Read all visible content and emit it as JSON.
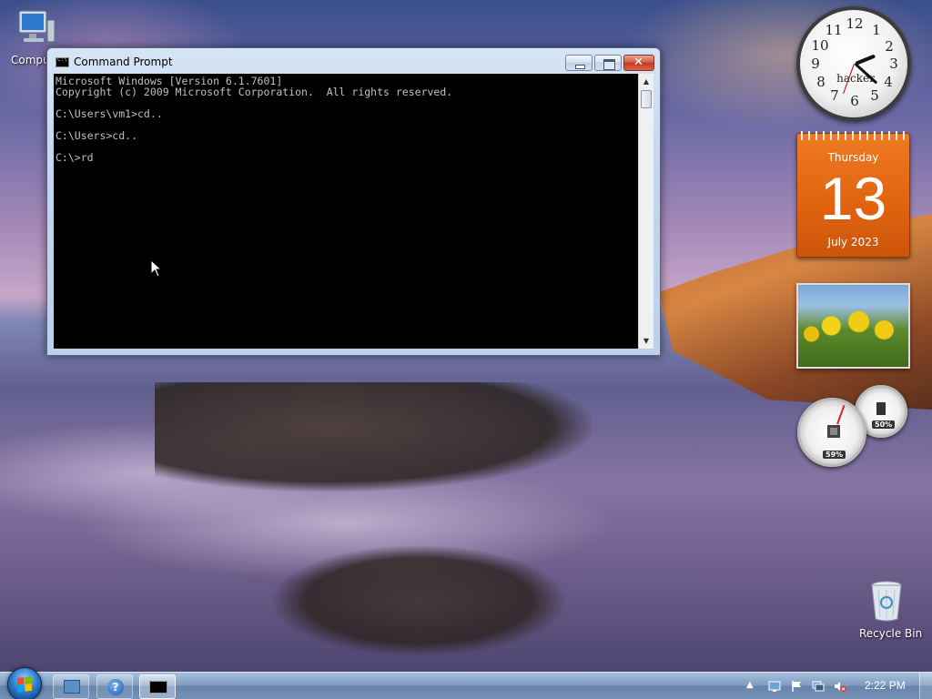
{
  "desktop": {
    "icons": [
      {
        "label": "Compu"
      },
      {
        "label": "Recycle Bin"
      }
    ]
  },
  "window": {
    "title": "Command Prompt",
    "buttons": {
      "minimize": "minimize-icon",
      "maximize": "maximize-icon",
      "close": "close-icon"
    },
    "console_lines": [
      "Microsoft Windows [Version 6.1.7601]",
      "Copyright (c) 2009 Microsoft Corporation.  All rights reserved.",
      "",
      "C:\\Users\\vm1>cd..",
      "",
      "C:\\Users>cd..",
      "",
      "C:\\>rd"
    ]
  },
  "gadgets": {
    "clock": {
      "label": "hacker",
      "numbers": [
        "12",
        "1",
        "2",
        "3",
        "4",
        "5",
        "6",
        "7",
        "8",
        "9",
        "10",
        "11"
      ]
    },
    "calendar": {
      "weekday": "Thursday",
      "date": "13",
      "month_year": "July 2023"
    },
    "cpu_meter": {
      "cpu": "59%",
      "memory": "50%"
    }
  },
  "taskbar": {
    "items": [
      "ie-icon",
      "help-icon",
      "cmd-icon"
    ],
    "tray_arrow": "▲",
    "time": "2:22 PM"
  },
  "colors": {
    "console_bg": "#000000",
    "console_text": "#c0c0c0",
    "calendar_orange": "#e0620f",
    "close_red": "#c43a20"
  }
}
